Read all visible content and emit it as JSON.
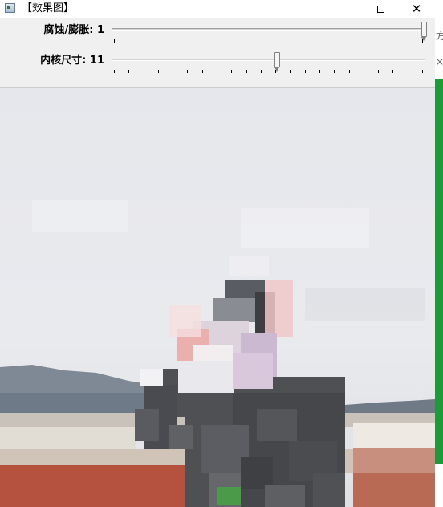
{
  "window": {
    "title": "【效果图】",
    "icon": "app-window-icon",
    "minimize_icon": "minimize-icon",
    "maximize_icon": "maximize-icon",
    "close_glyph": "✕"
  },
  "trackbars": [
    {
      "label": "腐蚀/膨胀: 1",
      "value": 1,
      "max": 1
    },
    {
      "label": "内核尺寸: 11",
      "value": 11,
      "max": 21
    }
  ],
  "image": {
    "description_icon": "processed-image",
    "colors": {
      "sky": "#e8e9ed",
      "hill": "#7b8592",
      "jacket": "#4d4e52",
      "wall": "#d5cec4",
      "brick": "#b84a3a"
    }
  },
  "side": {
    "edge_chars": [
      "方",
      "×"
    ]
  }
}
